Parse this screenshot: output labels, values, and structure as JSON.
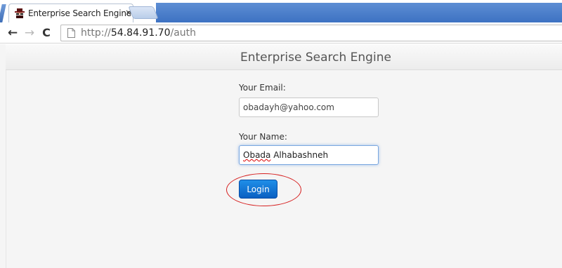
{
  "browser": {
    "tab": {
      "title": "Enterprise Search Engine",
      "close_glyph": "×"
    },
    "nav": {
      "back_glyph": "←",
      "forward_glyph": "→",
      "reload_glyph": "C"
    },
    "address": {
      "scheme": "http://",
      "host": "54.84.91.70",
      "path": "/auth"
    }
  },
  "page": {
    "title": "Enterprise Search Engine",
    "form": {
      "email_label": "Your Email:",
      "email_value": "obadayh@yahoo.com",
      "name_label": "Your Name:",
      "name_first": "Obada",
      "name_rest": " Alhabashneh",
      "login_label": "Login"
    }
  },
  "colors": {
    "tabstrip_blue": "#3d72c2",
    "login_button": "#0a5fc2",
    "annotation_red": "#d62020",
    "page_background": "#f5f5f5"
  },
  "icons": [
    "spy-favicon-icon",
    "close-icon",
    "back-arrow-icon",
    "forward-arrow-icon",
    "reload-icon",
    "page-icon"
  ]
}
